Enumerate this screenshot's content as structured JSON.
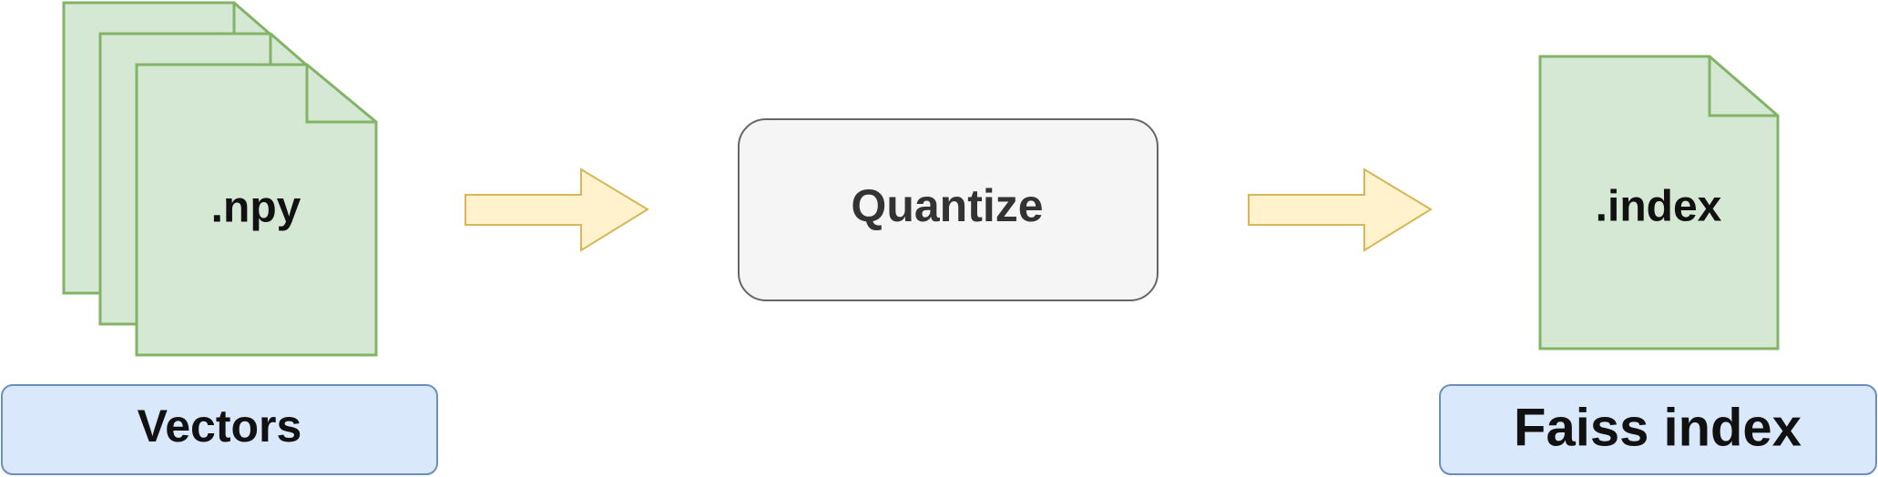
{
  "colors": {
    "file_fill": "#d5e8d4",
    "file_stroke": "#82b366",
    "arrow_fill": "#fff2cc",
    "arrow_stroke": "#d6b656",
    "process_fill": "#f5f5f5",
    "process_stroke": "#666666",
    "label_fill": "#dae8fc",
    "label_stroke": "#6c8ebf",
    "text_dark": "#111111",
    "text_process": "#333333"
  },
  "input_files": {
    "text": ".npy"
  },
  "input_label": {
    "text": "Vectors"
  },
  "process": {
    "text": "Quantize"
  },
  "output_file": {
    "text": ".index"
  },
  "output_label": {
    "text": "Faiss index"
  }
}
